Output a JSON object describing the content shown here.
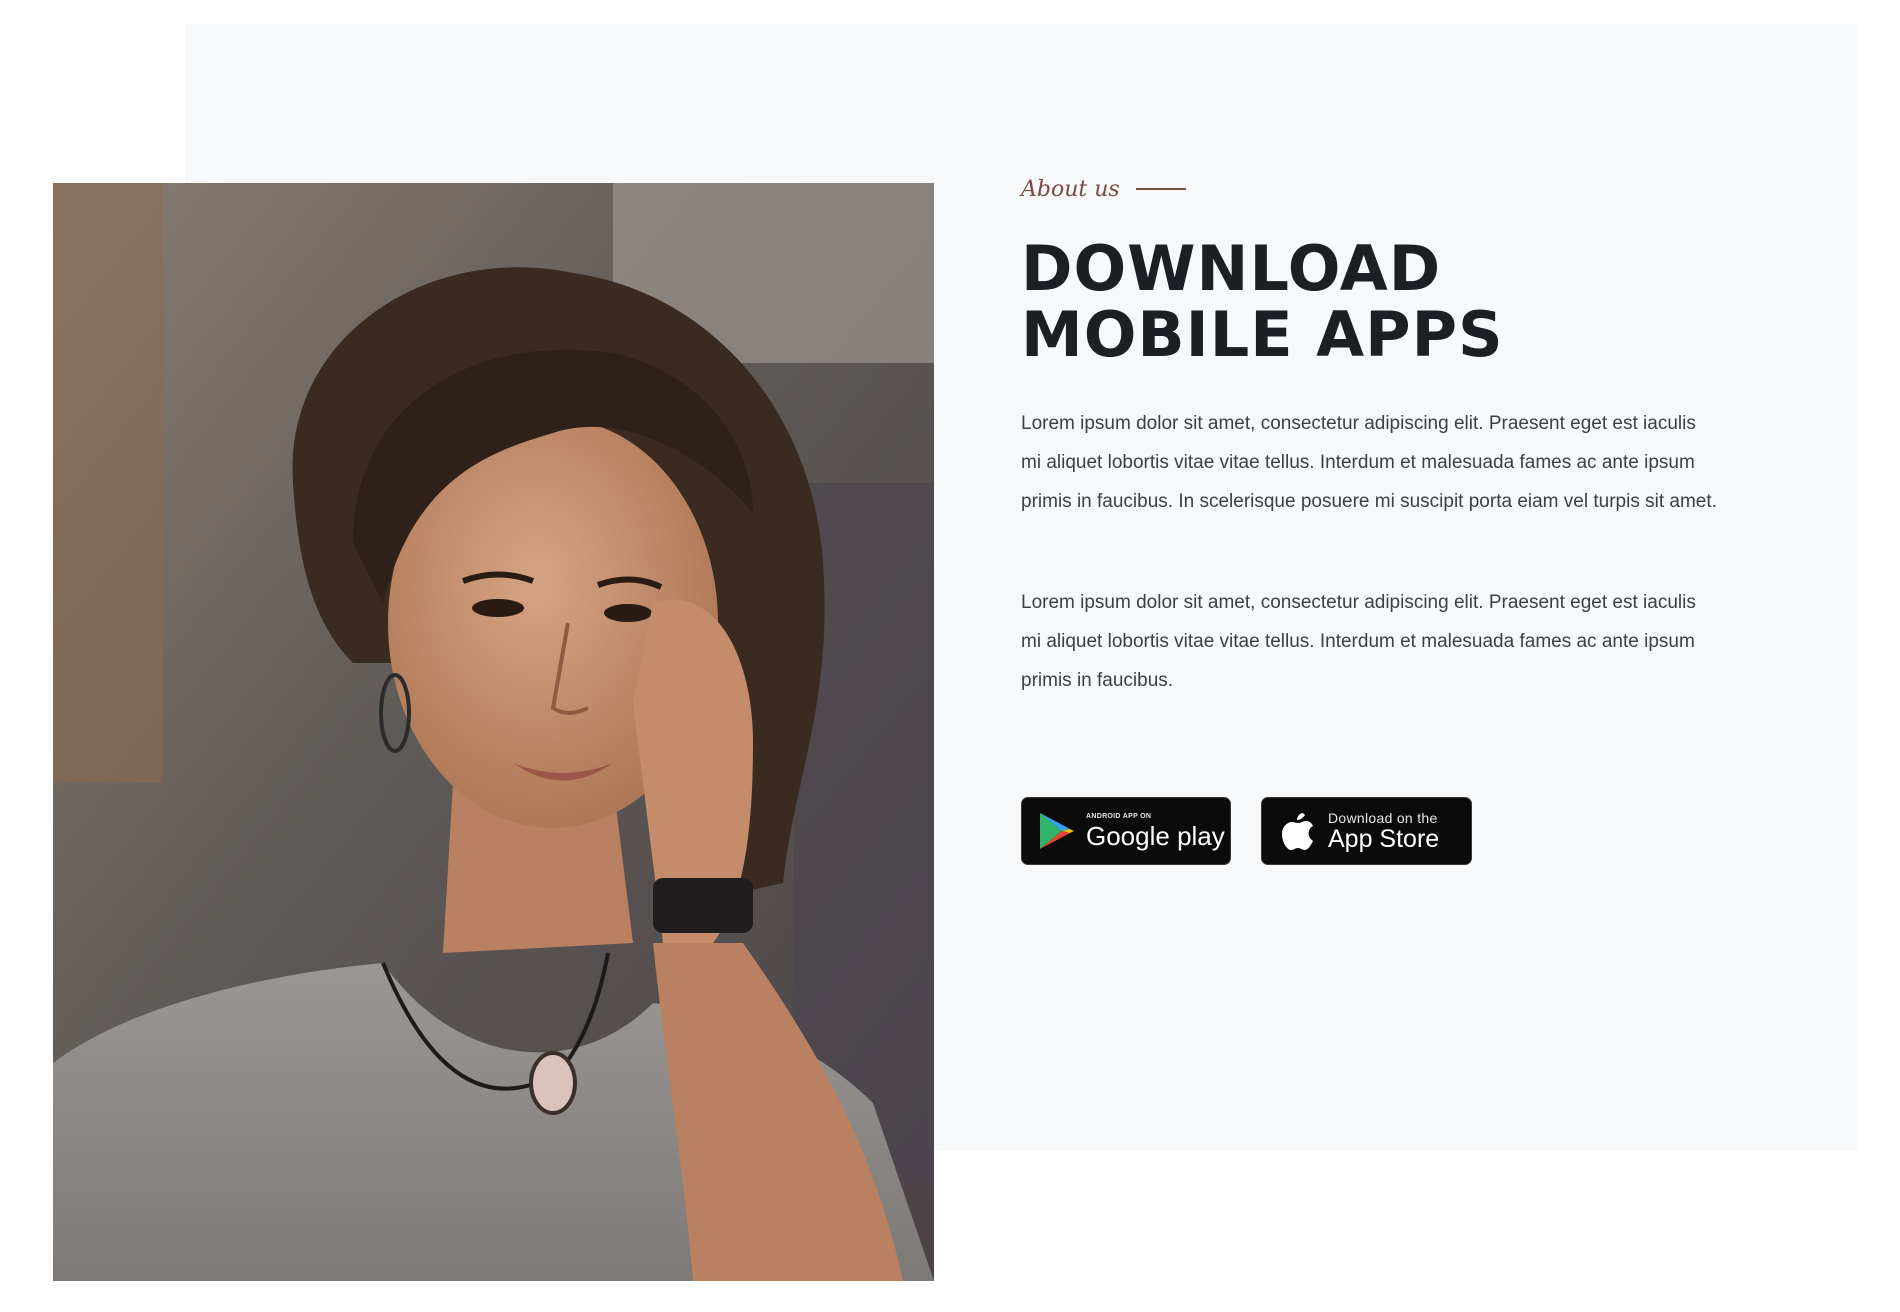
{
  "section": {
    "eyebrow": "About us",
    "title_line1": "DOWNLOAD",
    "title_line2": "MOBILE APPS",
    "paragraph1": "Lorem ipsum dolor sit amet, consectetur adipiscing elit. Praesent eget est iaculis mi aliquet lobortis vitae vitae tellus. Interdum et malesuada fames ac ante ipsum primis in faucibus. In scelerisque posuere mi suscipit porta eiam vel turpis sit amet.",
    "paragraph2": "Lorem ipsum dolor sit amet, consectetur adipiscing elit. Praesent eget est iaculis mi aliquet lobortis vitae vitae tellus. Interdum et malesuada fames ac ante ipsum primis in faucibus."
  },
  "stores": {
    "google": {
      "small_text": "ANDROID APP ON",
      "big_text": "Google play",
      "icon": "google-play-icon"
    },
    "apple": {
      "small_text": "Download on the",
      "big_text": "App Store",
      "icon": "apple-icon"
    }
  },
  "image": {
    "subject": "portrait-photo"
  },
  "colors": {
    "panel_background": "#f7f8f9",
    "heading": "#1c1f24",
    "accent": "#7a4a44",
    "body_text": "#3c3f45",
    "button_background": "#0b0b0b"
  }
}
